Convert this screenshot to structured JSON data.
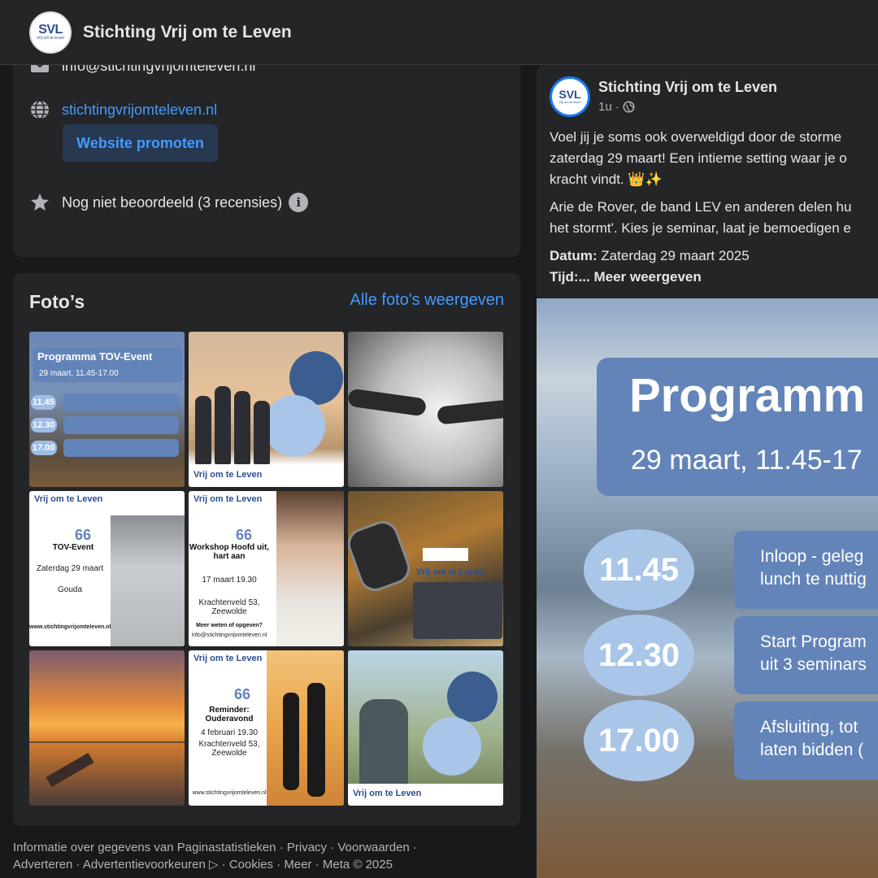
{
  "topbar": {
    "logo_text": "SVL",
    "logo_sub": "Vrij om te leven",
    "title": "Stichting Vrij om te Leven"
  },
  "about": {
    "email": "info@stichtingvrijomteleven.nl",
    "website": "stichtingvrijomteleven.nl",
    "promote_label": "Website promoten",
    "rating": "Nog niet beoordeeld (3 recensies)",
    "info_glyph": "i"
  },
  "photos": {
    "title": "Foto’s",
    "all_link": "Alle foto's weergeven",
    "tile1": {
      "title": "Programma TOV-Event",
      "subtitle": "29 maart, 11.45-17.00",
      "times": [
        "11.45",
        "12.30",
        "17.00"
      ]
    },
    "tile4": {
      "brand": "Vrij om te Leven",
      "quote": "66",
      "title": "TOV-Event",
      "date": "Zaterdag 29 maart",
      "place": "Gouda",
      "url": "www.stichtingvrijomteleven.nl"
    },
    "tile5": {
      "brand": "Vrij om te Leven",
      "quote": "66",
      "title": "Workshop Hoofd uit, hart aan",
      "date": "17 maart 19.30",
      "place": "Krachtenveld 53, Zeewolde",
      "cta": "Meer weten of opgeven?",
      "email": "info@stichtingvrijomteleven.nl"
    },
    "tile6": {
      "brand": "Vrij om te Leven"
    },
    "tile8": {
      "brand": "Vrij om te Leven",
      "quote": "66",
      "title": "Reminder: Ouderavond",
      "date": "4 februari 19.30",
      "place": "Krachtenveld 53, Zeewolde",
      "url": "www.stichtingvrijomteleven.nl"
    },
    "tile2": {
      "brand": "Vrij om te Leven"
    },
    "tile9": {
      "brand": "Vrij om te Leven"
    }
  },
  "footer": {
    "line1": "Informatie over gegevens van Paginastatistieken · Privacy · Voorwaarden ·",
    "line2": "Adverteren · Advertentievoorkeuren ▷ · Cookies · Meer · Meta © 2025"
  },
  "post": {
    "author": "Stichting Vrij om te Leven",
    "time": "1u ·",
    "para1_line1": "Voel jij je soms ook overweldigd door de storme",
    "para1_line2": "zaterdag 29 maart! Een intieme setting waar je o",
    "para1_line3": "kracht vindt. 👑✨",
    "para2_line1": "Arie de Rover, de band LEV en anderen delen hu",
    "para2_line2": "het stormt'. Kies je seminar, laat je bemoedigen e",
    "date_label": "Datum:",
    "date_value": "Zaterdag 29 maart 2025",
    "time_label": "Tijd:",
    "more": "... Meer weergeven",
    "image": {
      "title": "Programm",
      "subtitle": "29 maart, 11.45-17",
      "times": [
        "11.45",
        "12.30",
        "17.00"
      ],
      "box1_l1": "Inloop - geleg",
      "box1_l2": "lunch te nuttig",
      "box2_l1": "Start Program",
      "box2_l2": "uit 3 seminars",
      "box3_l1": "Afsluiting, tot",
      "box3_l2": "laten bidden ("
    }
  }
}
